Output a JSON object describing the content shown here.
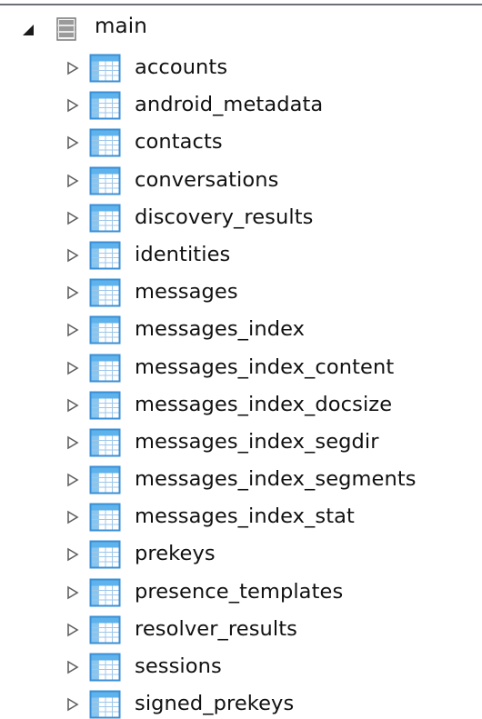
{
  "root": {
    "label": "main",
    "expanded": true,
    "icon": "database-icon"
  },
  "tables": [
    {
      "label": "accounts"
    },
    {
      "label": "android_metadata"
    },
    {
      "label": "contacts"
    },
    {
      "label": "conversations"
    },
    {
      "label": "discovery_results"
    },
    {
      "label": "identities"
    },
    {
      "label": "messages"
    },
    {
      "label": "messages_index"
    },
    {
      "label": "messages_index_content"
    },
    {
      "label": "messages_index_docsize"
    },
    {
      "label": "messages_index_segdir"
    },
    {
      "label": "messages_index_segments"
    },
    {
      "label": "messages_index_stat"
    },
    {
      "label": "prekeys"
    },
    {
      "label": "presence_templates"
    },
    {
      "label": "resolver_results"
    },
    {
      "label": "sessions"
    },
    {
      "label": "signed_prekeys"
    }
  ],
  "colors": {
    "table_icon_border": "#3a8fd6",
    "table_icon_header": "#5fb3ec",
    "table_icon_fill": "#ffffff",
    "expander": "#606060",
    "text": "#111111"
  }
}
